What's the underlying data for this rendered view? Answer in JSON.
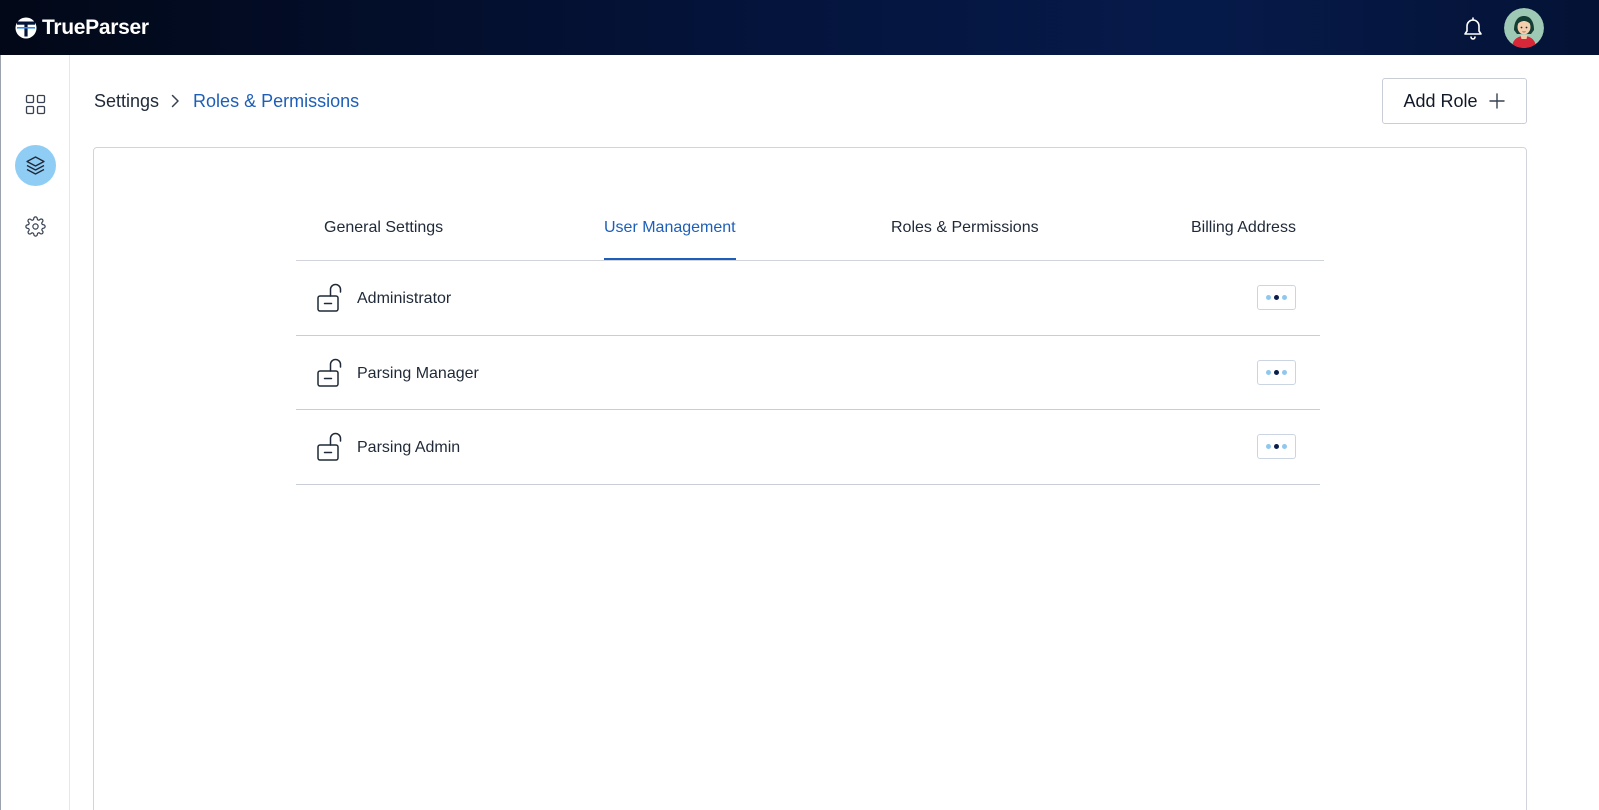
{
  "app": {
    "name": "TrueParser"
  },
  "header": {
    "notifications_icon": "bell-icon",
    "avatar_icon": "user-avatar"
  },
  "sidebar": {
    "items": [
      {
        "icon": "grid-icon",
        "active": false
      },
      {
        "icon": "layers-icon",
        "active": true
      },
      {
        "icon": "gear-icon",
        "active": false
      }
    ]
  },
  "breadcrumb": {
    "root": "Settings",
    "current": "Roles & Permissions"
  },
  "actions": {
    "add_role_label": "Add Role"
  },
  "tabs": [
    {
      "label": "General Settings",
      "active": false
    },
    {
      "label": "User Management",
      "active": true
    },
    {
      "label": "Roles & Permissions",
      "active": false
    },
    {
      "label": "Billing Address",
      "active": false
    }
  ],
  "roles": [
    {
      "name": "Administrator"
    },
    {
      "name": "Parsing Manager"
    },
    {
      "name": "Parsing Admin"
    }
  ],
  "colors": {
    "accent": "#1d5fb8",
    "sidebar_active": "#8fcdf5",
    "topbar": "#04133a"
  }
}
